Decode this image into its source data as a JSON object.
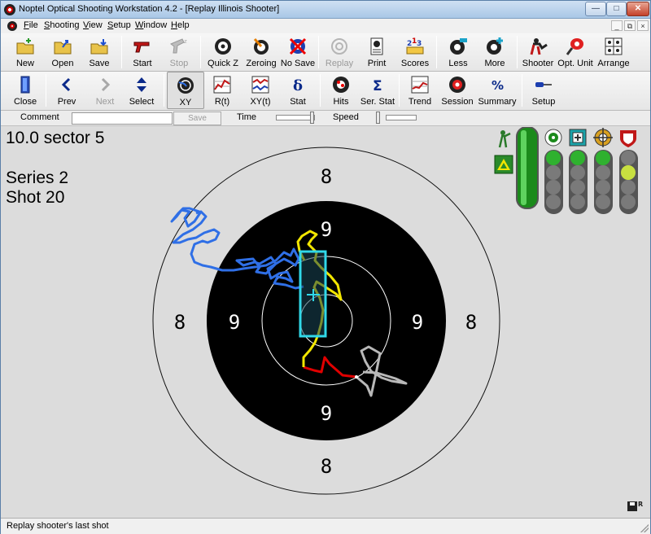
{
  "window": {
    "title": "Noptel Optical Shooting Workstation 4.2 - [Replay Illinois Shooter]"
  },
  "menu": {
    "items": [
      {
        "label": "File"
      },
      {
        "label": "Shooting"
      },
      {
        "label": "View"
      },
      {
        "label": "Setup"
      },
      {
        "label": "Window"
      },
      {
        "label": "Help"
      }
    ]
  },
  "toolbar1": [
    {
      "label": "New",
      "icon": "new-folder-icon",
      "enabled": true
    },
    {
      "label": "Open",
      "icon": "open-folder-icon",
      "enabled": true
    },
    {
      "label": "Save",
      "icon": "save-icon",
      "enabled": true
    },
    {
      "label": "Start",
      "icon": "pistol-icon",
      "enabled": true
    },
    {
      "label": "Stop",
      "icon": "stop-pistol-icon",
      "enabled": false
    },
    {
      "label": "Quick Z",
      "icon": "quick-zero-icon",
      "enabled": true
    },
    {
      "label": "Zeroing",
      "icon": "zeroing-icon",
      "enabled": true
    },
    {
      "label": "No Save",
      "icon": "no-save-icon",
      "enabled": true
    },
    {
      "label": "Replay",
      "icon": "replay-icon",
      "enabled": false
    },
    {
      "label": "Print",
      "icon": "print-icon",
      "enabled": true
    },
    {
      "label": "Scores",
      "icon": "scores-icon",
      "enabled": true
    },
    {
      "label": "Less",
      "icon": "less-icon",
      "enabled": true
    },
    {
      "label": "More",
      "icon": "more-icon",
      "enabled": true
    },
    {
      "label": "Shooter",
      "icon": "shooter-icon",
      "enabled": true
    },
    {
      "label": "Opt. Unit",
      "icon": "optical-unit-icon",
      "enabled": true
    },
    {
      "label": "Arrange",
      "icon": "arrange-icon",
      "enabled": true
    }
  ],
  "toolbar2": [
    {
      "label": "Close",
      "icon": "close-door-icon",
      "enabled": true
    },
    {
      "label": "Prev",
      "icon": "chevron-left-icon",
      "enabled": true
    },
    {
      "label": "Next",
      "icon": "chevron-right-icon",
      "enabled": false
    },
    {
      "label": "Select",
      "icon": "select-updown-icon",
      "enabled": true
    },
    {
      "label": "XY",
      "icon": "xy-target-icon",
      "enabled": true,
      "pressed": true
    },
    {
      "label": "R(t)",
      "icon": "r-t-graph-icon",
      "enabled": true
    },
    {
      "label": "XY(t)",
      "icon": "xy-t-graph-icon",
      "enabled": true
    },
    {
      "label": "Stat",
      "icon": "delta-icon",
      "enabled": true
    },
    {
      "label": "Hits",
      "icon": "hits-target-icon",
      "enabled": true
    },
    {
      "label": "Ser. Stat",
      "icon": "sigma-icon",
      "enabled": true
    },
    {
      "label": "Trend",
      "icon": "trend-graph-icon",
      "enabled": true
    },
    {
      "label": "Session",
      "icon": "session-target-icon",
      "enabled": true
    },
    {
      "label": "Summary",
      "icon": "percent-icon",
      "enabled": true
    },
    {
      "label": "Setup",
      "icon": "screwdriver-icon",
      "enabled": true
    }
  ],
  "cmdbar": {
    "comment_label": "Comment",
    "comment_value": "",
    "save_label": "Save",
    "time_label": "Time",
    "speed_label": "Speed"
  },
  "shot": {
    "score_text": "10.0 sector 5",
    "series_text": "Series 2",
    "shot_text": "Shot 20"
  },
  "target": {
    "ring_numbers": [
      "8",
      "8",
      "8",
      "8",
      "9",
      "9",
      "9",
      "9"
    ]
  },
  "indicators": {
    "icons": [
      "shooter-standing-icon",
      "position-triangle-icon"
    ],
    "column_icons": [
      "ring-10-icon",
      "square-plus-icon",
      "crosshair-icon",
      "shield-icon"
    ]
  },
  "colors": {
    "trace_blue": "#2f6fe6",
    "trace_yellow": "#f2e600",
    "trace_red": "#e00000",
    "trace_gray": "#b8b8b8",
    "hold_box": "#30d8e8",
    "target_black": "#000000",
    "led_green": "#2fb12f",
    "led_gray": "#7a7a7a"
  },
  "status": {
    "text": "Replay shooter's last shot"
  }
}
